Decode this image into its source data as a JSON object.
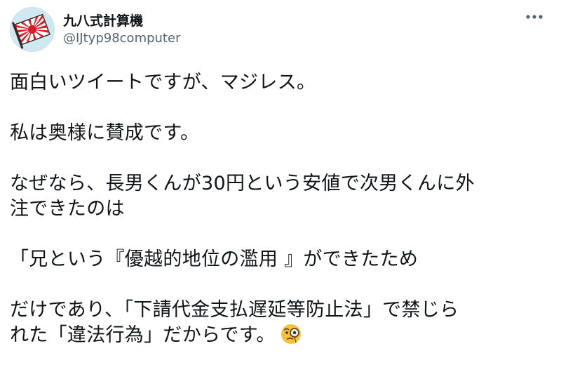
{
  "tweet": {
    "display_name": "九八式計算機",
    "handle": "@IJtyp98computer",
    "avatar_icon": "rising-sun-flag-avatar-icon",
    "more_icon": "more-options-icon",
    "lines": [
      "面白いツイートですが、マジレス。",
      "私は奥様に賛成です。",
      "なぜなら、長男くんが30円という安値で次男くんに外",
      "注できたのは",
      "「兄という『優越的地位の濫用 』ができたため",
      "だけであり、「下請代金支払遅延等防止法」で禁じら",
      "れた「違法行為」だからです。"
    ],
    "end_emoji": "face-with-monocle-emoji",
    "colors": {
      "text": "#0f1419",
      "secondary": "#536471",
      "emoji_face": "#f6c23b"
    }
  }
}
